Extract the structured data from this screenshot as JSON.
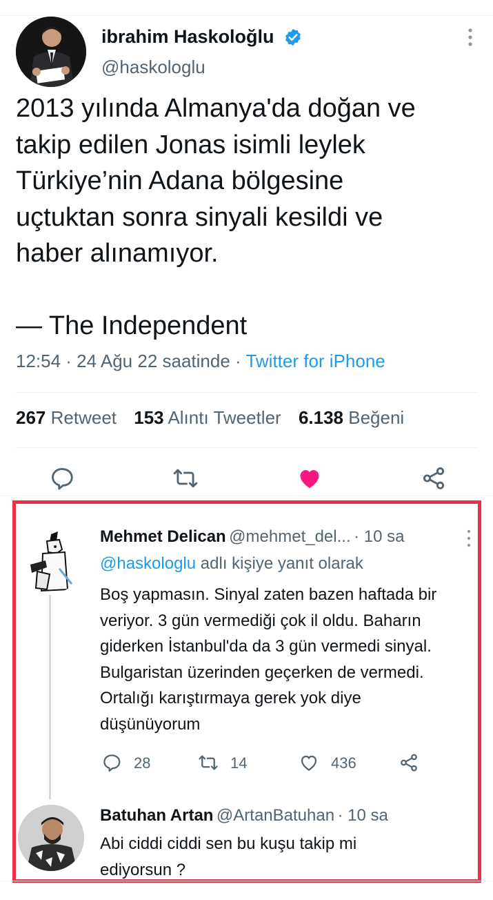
{
  "tweet": {
    "author_name": "ibrahim Haskoloğlu",
    "author_handle": "@haskologlu",
    "text": "2013 yılında Almanya'da doğan ve\ntakip edilen Jonas isimli leylek\nTürkiye’nin Adana bölgesine\nuçtuktan sonra sinyali kesildi ve\nhaber alınamıyor.\n\n— The Independent",
    "time": "12:54 · 24 Ağu 22 saatinde · ",
    "source": "Twitter for iPhone",
    "stats": {
      "retweets": "267",
      "retweets_label": "Retweet",
      "quotes": "153",
      "quotes_label": "Alıntı Tweetler",
      "likes": "6.138",
      "likes_label": "Beğeni"
    },
    "actions": [
      "reply-icon",
      "retweet-icon",
      "heart-filled-icon",
      "share-icon"
    ],
    "like_color": "#f91880"
  },
  "replies": [
    {
      "name": "Mehmet Delican",
      "handle": "@mehmet_del...",
      "time": "· 10 sa",
      "reply_to_mention": "@haskologlu",
      "reply_to_suffix": " adlı kişiye yanıt olarak",
      "text": "Boş yapmasın. Sinyal zaten bazen haftada bir veriyor. 3 gün vermediği çok il oldu. Baharın giderken İstanbul'da da 3 gün vermedi sinyal. Bulgaristan üzerinden geçerken de vermedi. Ortalığı karıştırmaya gerek yok diye düşünüyorum",
      "replies_count": "28",
      "retweets_count": "14",
      "likes_count": "436"
    },
    {
      "name": "Batuhan Artan",
      "handle": "@ArtanBatuhan",
      "time": "· 10 sa",
      "text": "Abi ciddi ciddi sen bu kuşu takip mi ediyorsun ?"
    }
  ],
  "colors": {
    "accent": "#1d9bf0",
    "secondary_text": "#536471",
    "highlight_border": "#ef2e45"
  }
}
